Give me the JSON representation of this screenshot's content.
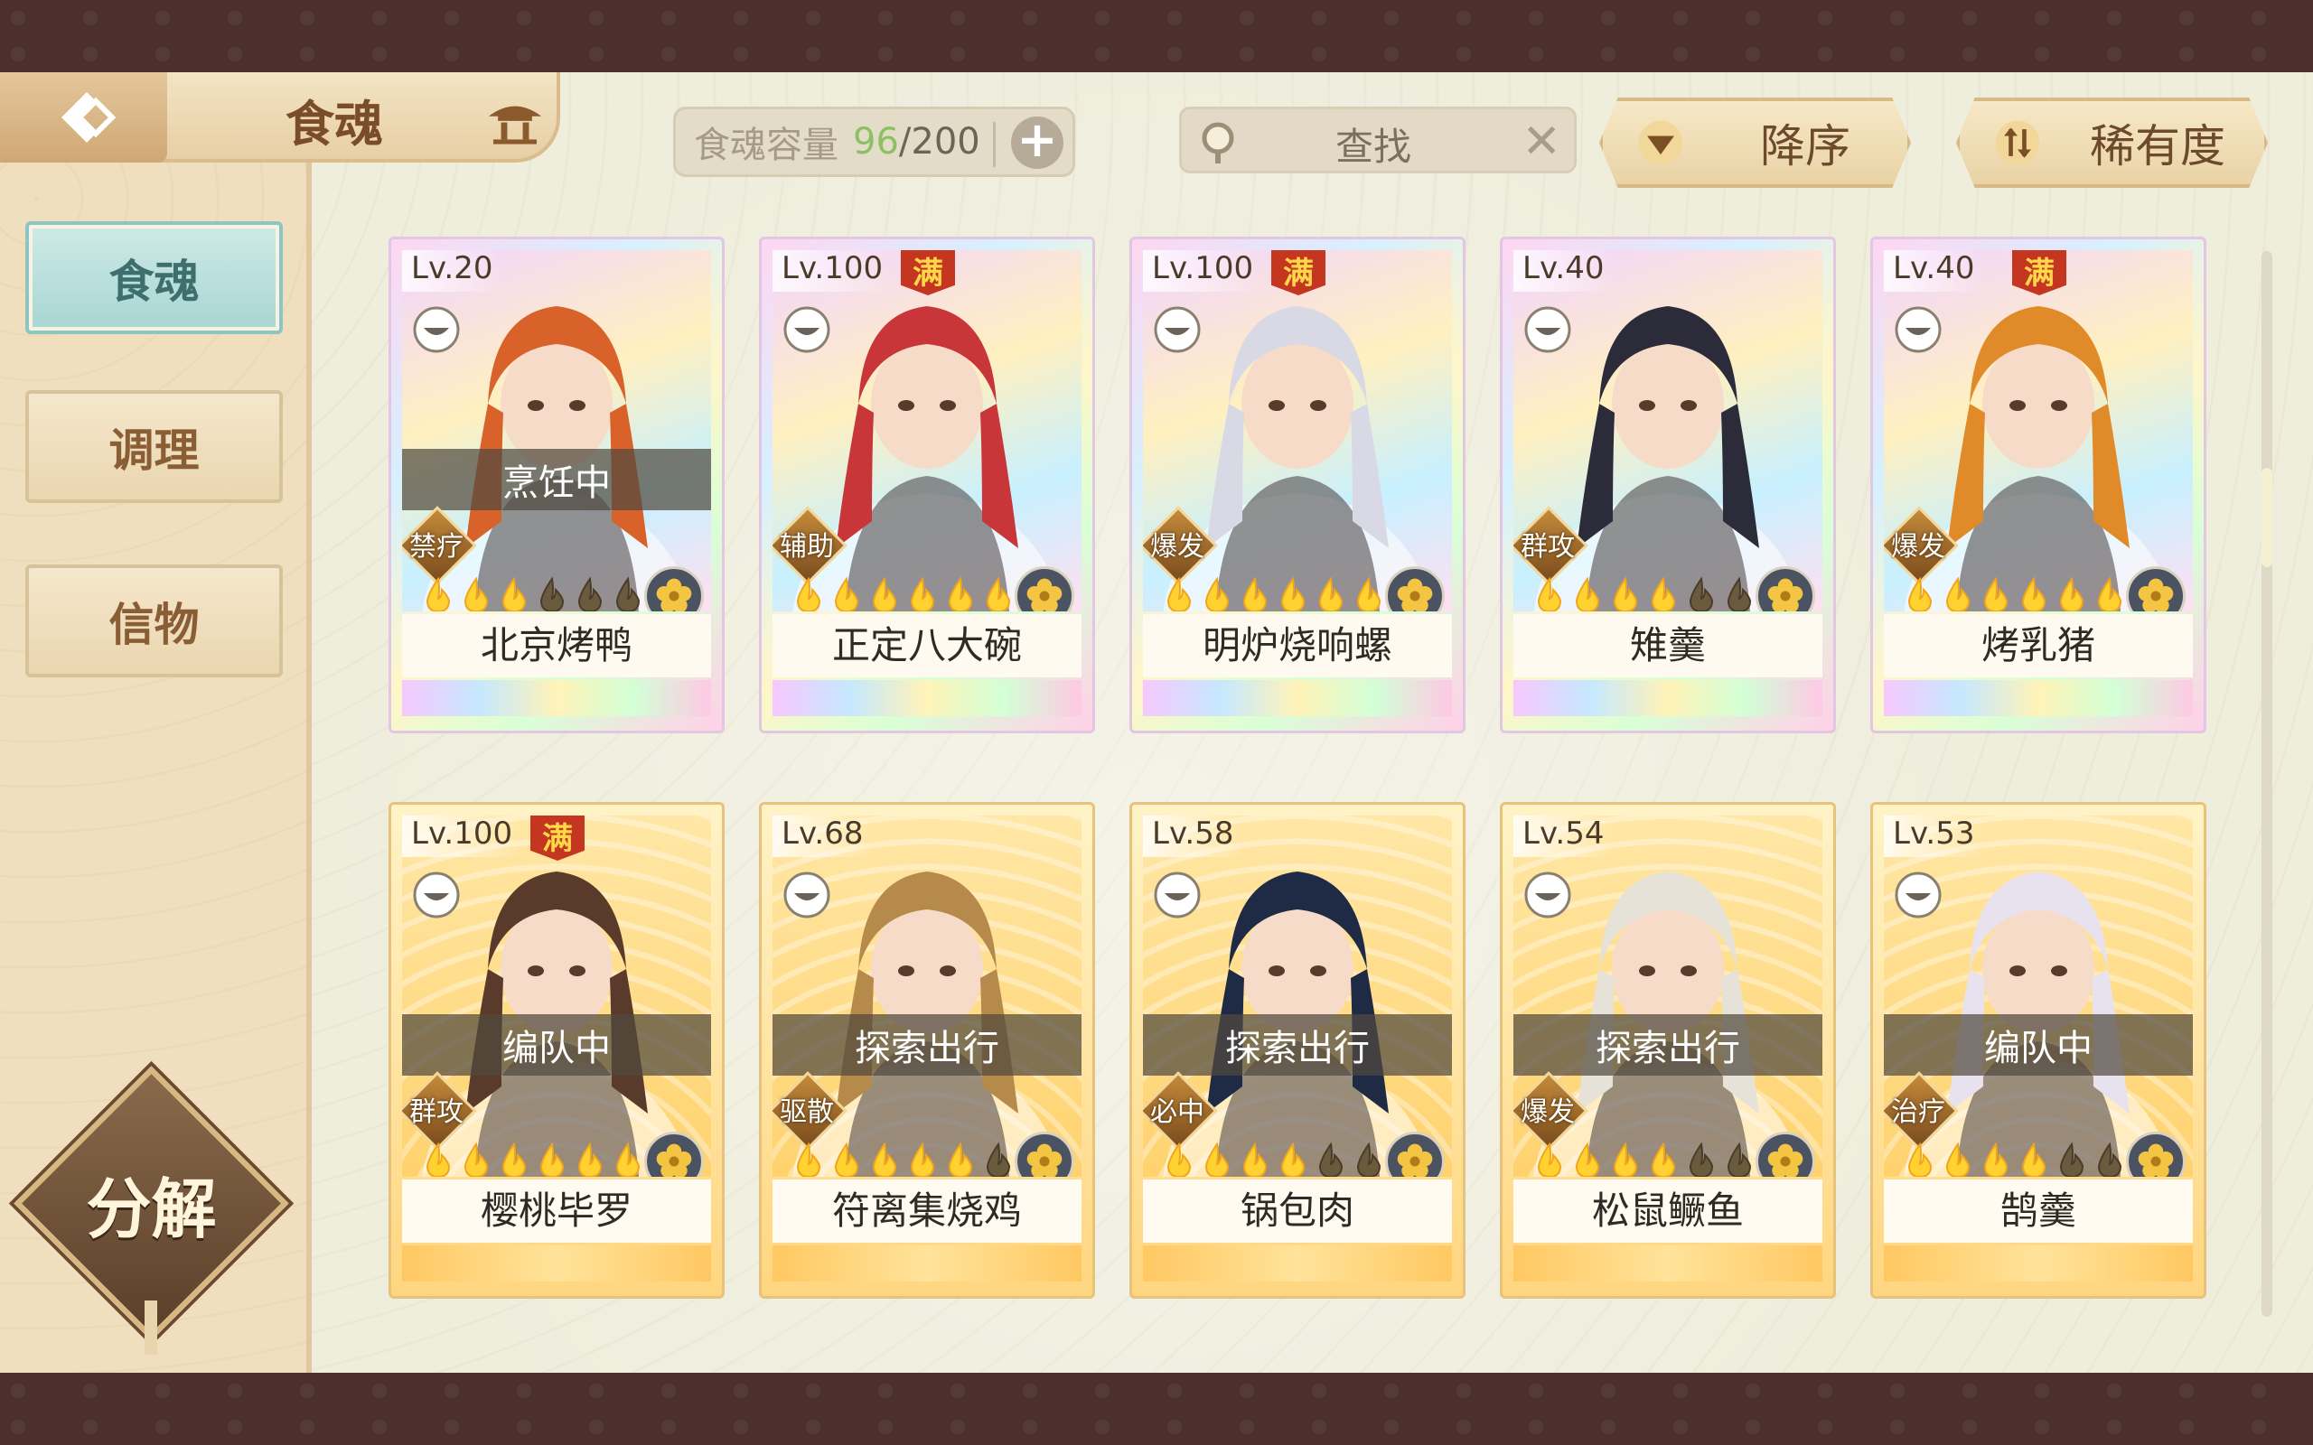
{
  "header": {
    "title": "食魂",
    "capacity_label": "食魂容量",
    "capacity_current": "96",
    "capacity_max": "/200",
    "search_label": "查找",
    "sort_order_label": "降序",
    "sort_key_label": "稀有度"
  },
  "sidebar": {
    "tabs": [
      {
        "label": "食魂",
        "active": true
      },
      {
        "label": "调理",
        "active": false
      },
      {
        "label": "信物",
        "active": false
      }
    ],
    "decompose_label": "分解"
  },
  "colors": {
    "accent_teal": "#a7d6d2",
    "capacity_green": "#8cc063",
    "frame_brown": "#4b302d"
  },
  "cards": [
    {
      "level": "Lv.20",
      "full": false,
      "status": "烹饪中",
      "role": "禁疗",
      "stars": 3,
      "max_stars": 6,
      "name": "北京烤鸭",
      "rarity": "rainbow"
    },
    {
      "level": "Lv.100",
      "full": true,
      "status": "",
      "role": "辅助",
      "stars": 6,
      "max_stars": 6,
      "name": "正定八大碗",
      "rarity": "rainbow"
    },
    {
      "level": "Lv.100",
      "full": true,
      "status": "",
      "role": "爆发",
      "stars": 6,
      "max_stars": 6,
      "name": "明炉烧响螺",
      "rarity": "rainbow"
    },
    {
      "level": "Lv.40",
      "full": false,
      "status": "",
      "role": "群攻",
      "stars": 4,
      "max_stars": 6,
      "name": "雉羹",
      "rarity": "rainbow"
    },
    {
      "level": "Lv.40",
      "full": true,
      "status": "",
      "role": "爆发",
      "stars": 6,
      "max_stars": 6,
      "name": "烤乳猪",
      "rarity": "rainbow"
    },
    {
      "level": "Lv.100",
      "full": true,
      "status": "编队中",
      "role": "群攻",
      "stars": 6,
      "max_stars": 6,
      "name": "樱桃毕罗",
      "rarity": "gold"
    },
    {
      "level": "Lv.68",
      "full": false,
      "status": "探索出行",
      "role": "驱散",
      "stars": 5,
      "max_stars": 6,
      "name": "符离集烧鸡",
      "rarity": "gold"
    },
    {
      "level": "Lv.58",
      "full": false,
      "status": "探索出行",
      "role": "必中",
      "stars": 4,
      "max_stars": 6,
      "name": "锅包肉",
      "rarity": "gold"
    },
    {
      "level": "Lv.54",
      "full": false,
      "status": "探索出行",
      "role": "爆发",
      "stars": 4,
      "max_stars": 6,
      "name": "松鼠鳜鱼",
      "rarity": "gold"
    },
    {
      "level": "Lv.53",
      "full": false,
      "status": "编队中",
      "role": "治疗",
      "stars": 4,
      "max_stars": 6,
      "name": "鹄羹",
      "rarity": "gold"
    }
  ]
}
